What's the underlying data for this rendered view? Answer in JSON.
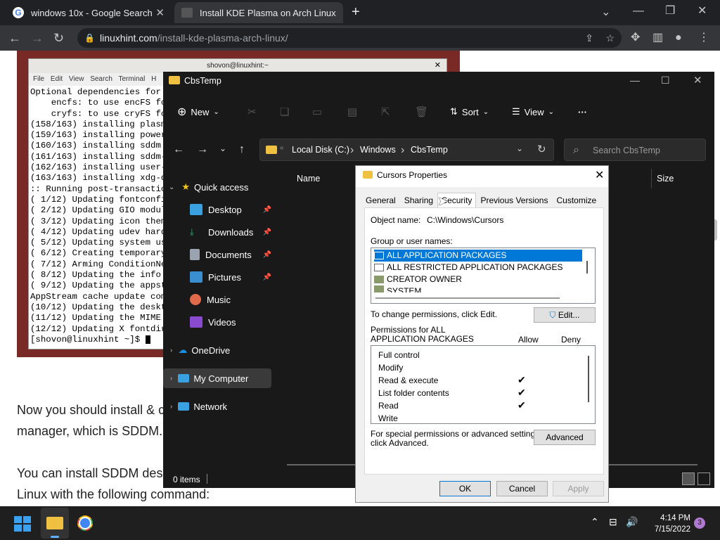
{
  "browser": {
    "tabs": [
      {
        "title": "windows 10x - Google Search"
      },
      {
        "title": "Install KDE Plasma on Arch Linux"
      }
    ],
    "new_tab": "+",
    "url_host": "linuxhint.com",
    "url_path": "/install-kde-plasma-arch-linux/"
  },
  "article": {
    "para1_line1": "Now you should install & c",
    "para1_line2": "manager, which is SDDM.",
    "para2_line1": "You can install SDDM des",
    "para2_line2": "Linux with the following command:"
  },
  "terminal": {
    "title": "shovon@linuxhint:~",
    "menu": [
      "File",
      "Edit",
      "View",
      "Search",
      "Terminal",
      "H"
    ],
    "lines": [
      "Optional dependencies for",
      "    encfs: to use encFS fo",
      "    cryfs: to use cryFS fo",
      "(158/163) installing plasm",
      "(159/163) installing power",
      "(160/163) installing sddm",
      "(161/163) installing sddm-",
      "(162/163) installing user-",
      "(163/163) installing xdg-d",
      ":: Running post-transactio",
      "( 1/12) Updating fontconfi",
      "( 2/12) Updating GIO modul",
      "( 3/12) Updating icon them",
      "( 4/12) Updating udev hard",
      "( 5/12) Updating system us",
      "( 6/12) Creating temporary",
      "( 7/12) Arming ConditionNe",
      "( 8/12) Updating the info",
      "( 9/12) Updating the appst",
      "AppStream cache update com",
      "(10/12) Updating the deskt",
      "(11/12) Updating the MIME",
      "(12/12) Updating X fontdir",
      "[shovon@linuxhint ~]$ "
    ]
  },
  "explorer": {
    "title": "CbsTemp",
    "new_label": "New",
    "sort_label": "Sort",
    "view_label": "View",
    "more_label": "···",
    "breadcrumb": [
      "Local Disk (C:)",
      "Windows",
      "CbsTemp"
    ],
    "search_placeholder": "Search CbsTemp",
    "col_name": "Name",
    "col_size": "Size",
    "nav": {
      "quick_access": "Quick access",
      "desktop": "Desktop",
      "downloads": "Downloads",
      "documents": "Documents",
      "pictures": "Pictures",
      "music": "Music",
      "videos": "Videos",
      "onedrive": "OneDrive",
      "my_computer": "My Computer",
      "network": "Network"
    },
    "status": "0 items"
  },
  "dialog": {
    "title": "Cursors Properties",
    "tabs": [
      "General",
      "Sharing",
      "Security",
      "Previous Versions",
      "Customize"
    ],
    "object_label": "Object name:",
    "object_value": "C:\\Windows\\Cursors",
    "group_label": "Group or user names:",
    "groups": [
      "ALL APPLICATION PACKAGES",
      "ALL RESTRICTED APPLICATION PACKAGES",
      "CREATOR OWNER",
      "SYSTEM"
    ],
    "change_text": "To change permissions, click Edit.",
    "edit_btn": "Edit...",
    "perm_for_1": "Permissions for ALL",
    "perm_for_2": "APPLICATION PACKAGES",
    "allow": "Allow",
    "deny": "Deny",
    "permissions": [
      {
        "name": "Full control",
        "allow": false
      },
      {
        "name": "Modify",
        "allow": false
      },
      {
        "name": "Read & execute",
        "allow": true
      },
      {
        "name": "List folder contents",
        "allow": true
      },
      {
        "name": "Read",
        "allow": true
      },
      {
        "name": "Write",
        "allow": false
      }
    ],
    "special_1": "For special permissions or advanced settings,",
    "special_2": "click Advanced.",
    "advanced_btn": "Advanced",
    "ok": "OK",
    "cancel": "Cancel",
    "apply": "Apply",
    "check": "✔"
  },
  "taskbar": {
    "time": "4:14 PM",
    "date": "7/15/2022",
    "badge": "3"
  },
  "colors": {
    "accent": "#0078d7",
    "selection": "#0078d7",
    "chrome_bg": "#202124"
  }
}
